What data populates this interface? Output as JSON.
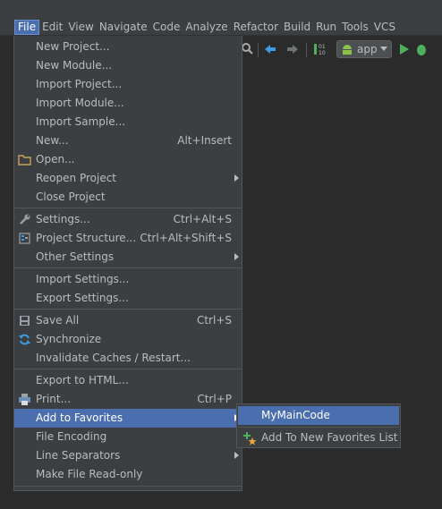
{
  "menubar": {
    "items": [
      {
        "label": "File",
        "active": true
      },
      {
        "label": "Edit"
      },
      {
        "label": "View"
      },
      {
        "label": "Navigate"
      },
      {
        "label": "Code"
      },
      {
        "label": "Analyze"
      },
      {
        "label": "Refactor"
      },
      {
        "label": "Build"
      },
      {
        "label": "Run"
      },
      {
        "label": "Tools"
      },
      {
        "label": "VCS"
      }
    ]
  },
  "toolbar": {
    "run_config": "app",
    "colors": {
      "back_arrow": "#3d9ce3",
      "run": "#4cb15a",
      "android": "#8bc34a"
    }
  },
  "file_menu": {
    "items": [
      {
        "label": "New Project..."
      },
      {
        "label": "New Module..."
      },
      {
        "label": "Import Project..."
      },
      {
        "label": "Import Module..."
      },
      {
        "label": "Import Sample..."
      },
      {
        "label": "New...",
        "shortcut": "Alt+Insert"
      },
      {
        "label": "Open...",
        "icon": "folder-icon"
      },
      {
        "label": "Reopen Project",
        "submenu": true
      },
      {
        "label": "Close Project"
      },
      {
        "label": "Settings...",
        "shortcut": "Ctrl+Alt+S",
        "icon": "wrench-icon"
      },
      {
        "label": "Project Structure...",
        "shortcut": "Ctrl+Alt+Shift+S",
        "icon": "project-structure-icon"
      },
      {
        "label": "Other Settings",
        "submenu": true
      },
      {
        "label": "Import Settings..."
      },
      {
        "label": "Export Settings..."
      },
      {
        "label": "Save All",
        "shortcut": "Ctrl+S",
        "icon": "save-icon"
      },
      {
        "label": "Synchronize",
        "icon": "sync-icon"
      },
      {
        "label": "Invalidate Caches / Restart..."
      },
      {
        "label": "Export to HTML..."
      },
      {
        "label": "Print...",
        "shortcut": "Ctrl+P",
        "icon": "print-icon"
      },
      {
        "label": "Add to Favorites",
        "submenu": true,
        "highlighted": true
      },
      {
        "label": "File Encoding"
      },
      {
        "label": "Line Separators",
        "submenu": true
      },
      {
        "label": "Make File Read-only"
      }
    ]
  },
  "favorites_submenu": {
    "items": [
      {
        "label": "MyMainCode",
        "highlighted": true
      },
      {
        "label": "Add To New Favorites List",
        "icon": "add-favorites-icon"
      }
    ]
  },
  "colors": {
    "highlight": "#4b6eaf",
    "menu_bg": "#3c3f41",
    "text": "#bbbbbb"
  }
}
